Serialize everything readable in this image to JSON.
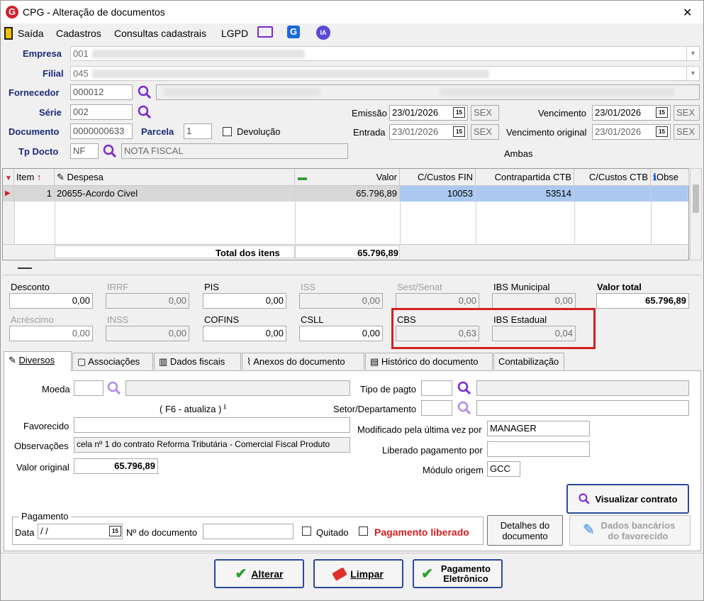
{
  "window": {
    "title": "CPG - Alteração de documentos",
    "close": "✕"
  },
  "menu": {
    "items": [
      "Saída",
      "Cadastros",
      "Consultas cadastrais",
      "LGPD"
    ],
    "ia": "IA"
  },
  "header": {
    "empresa_label": "Empresa",
    "empresa_code": "001",
    "filial_label": "Filial",
    "filial_code": "045",
    "fornecedor_label": "Fornecedor",
    "fornecedor_code": "000012",
    "serie_label": "Série",
    "serie_value": "002",
    "documento_label": "Documento",
    "documento_value": "0000000633",
    "parcela_label": "Parcela",
    "parcela_value": "1",
    "devolucao_label": "Devolução",
    "tpdocto_label": "Tp Docto",
    "tpdocto_code": "NF",
    "tpdocto_desc": "NOTA FISCAL",
    "emissao_label": "Emissão",
    "emissao_date": "23/01/2026",
    "emissao_day": "SEX",
    "entrada_label": "Entrada",
    "entrada_date": "23/01/2026",
    "entrada_day": "SEX",
    "vencimento_label": "Vencimento",
    "vencimento_date": "23/01/2026",
    "vencimento_day": "SEX",
    "venc_original_label": "Vencimento original",
    "venc_original_date": "23/01/2026",
    "venc_original_day": "SEX",
    "ambas": "Ambas",
    "cal_icon_text": "15"
  },
  "grid": {
    "columns": [
      "Item",
      "Despesa",
      "Valor",
      "C/Custos FIN",
      "Contrapartida CTB",
      "C/Custos CTB",
      "Obse"
    ],
    "row": {
      "item": "1",
      "despesa": "20655-Acordo Civel",
      "valor": "65.796,89",
      "ccfin": "10053",
      "contrapartida": "53514",
      "ccctb": ""
    },
    "total_label": "Total dos itens",
    "total_value": "65.796,89"
  },
  "taxes": {
    "desconto_label": "Desconto",
    "desconto": "0,00",
    "irrf_label": "IRRF",
    "irrf": "0,00",
    "pis_label": "PIS",
    "pis": "0,00",
    "iss_label": "ISS",
    "iss": "0,00",
    "sest_label": "Sest/Senat",
    "sest": "0,00",
    "ibsmun_label": "IBS Municipal",
    "ibsmun": "0,00",
    "valortotal_label": "Valor total",
    "valortotal": "65.796,89",
    "acrescimo_label": "Acréscimo",
    "acrescimo": "0,00",
    "inss_label": "INSS",
    "inss": "0,00",
    "cofins_label": "COFINS",
    "cofins": "0,00",
    "csll_label": "CSLL",
    "csll": "0,00",
    "cbs_label": "CBS",
    "cbs": "0,63",
    "ibsest_label": "IBS Estadual",
    "ibsest": "0,04"
  },
  "tabs": [
    "Diversos",
    "Associações",
    "Dados fiscais",
    "Anexos do documento",
    "Histórico do documento",
    "Contabilização"
  ],
  "diversos": {
    "moeda_label": "Moeda",
    "f6_label": "( F6 - atualiza )",
    "favorecido_label": "Favorecido",
    "observacoes_label": "Observações",
    "observacoes_value": "cela nº 1 do contrato Reforma Tributária - Comercial Fiscal Produto",
    "valororiginal_label": "Valor original",
    "valororiginal_value": "65.796,89",
    "tipopagto_label": "Tipo de pagto",
    "setor_label": "Setor/Departamento",
    "modificado_label": "Modificado pela última vez por",
    "modificado_value": "MANAGER",
    "liberado_label": "Liberado pagamento por",
    "modulo_label": "Módulo origem",
    "modulo_value": "GCC",
    "visualizar_btn": "Visualizar contrato"
  },
  "pagamento": {
    "group_label": "Pagamento",
    "data_label": "Data",
    "data_value": " /  /",
    "ndoc_label": "Nº do documento",
    "quitado_label": "Quitado",
    "liberado_label": "Pagamento liberado",
    "detalhes_btn": "Detalhes do documento",
    "dados_bancarios_btn": "Dados bancários do favorecido"
  },
  "footer": {
    "alterar": "Alterar",
    "limpar": "Limpar",
    "pagamento_eletronico": "Pagamento Eletrônico"
  },
  "colors": {
    "label_blue": "#1a2a7a",
    "highlight_red": "#d32020",
    "selection_blue": "#aac8f0",
    "accent_purple": "#7a2ad0"
  }
}
